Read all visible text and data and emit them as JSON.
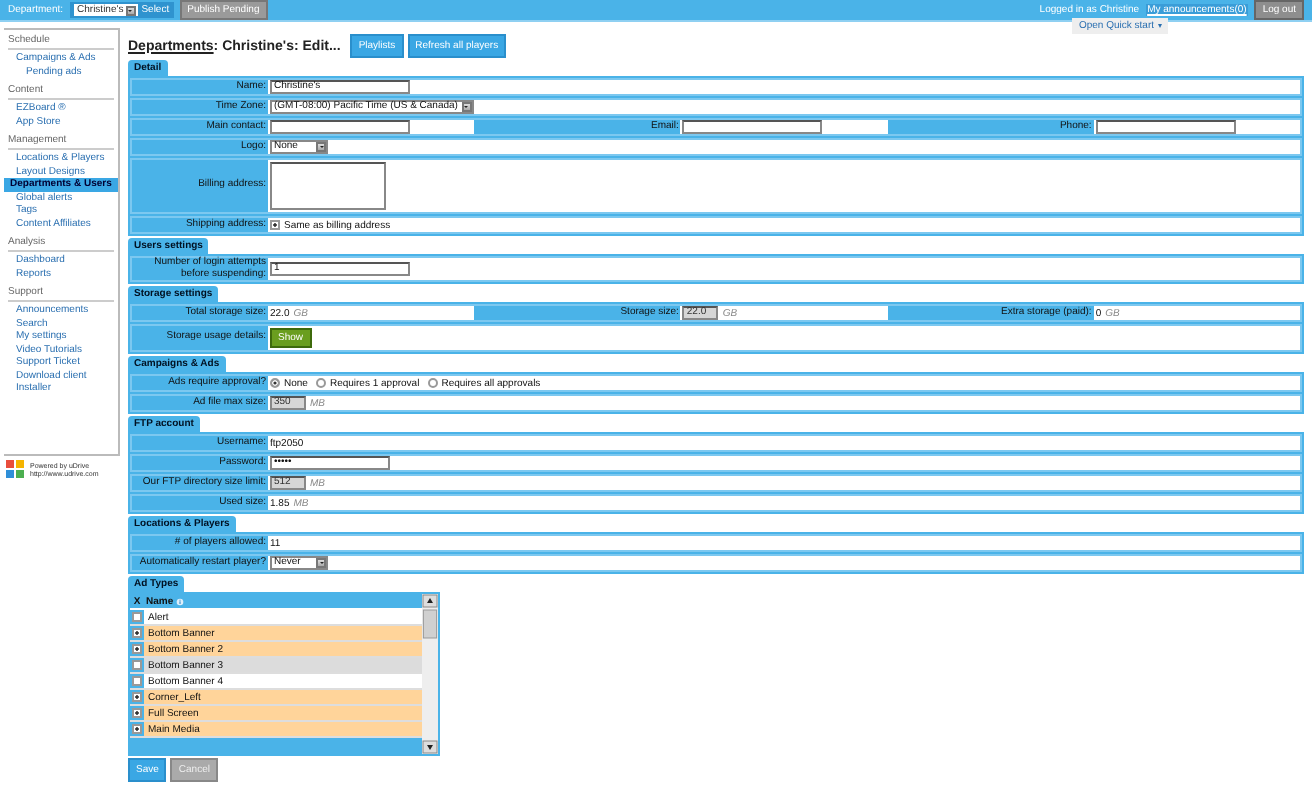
{
  "top_bar": {
    "department_label": "Department:",
    "department_select": "Christine's",
    "select_button": "Select",
    "publish_button": "Publish Pending",
    "logged_in": "Logged in as Christine",
    "announcements_link": "My announcements(0)",
    "logout_button": "Log out"
  },
  "quick_start": "Open Quick start",
  "sidebar": {
    "groups": [
      {
        "title": "Schedule",
        "items": [
          {
            "label": "Campaigns & Ads",
            "selected": false,
            "children": [
              {
                "label": "Pending ads",
                "selected": false
              }
            ]
          }
        ]
      },
      {
        "title": "Content",
        "items": [
          {
            "label": "EZBoard ®",
            "selected": false
          },
          {
            "label": "App Store",
            "selected": false
          }
        ]
      },
      {
        "title": "Management",
        "items": [
          {
            "label": "Locations & Players",
            "selected": false
          },
          {
            "label": "Layout Designs",
            "selected": false
          },
          {
            "label": "Departments & Users",
            "selected": true
          },
          {
            "label": "Global alerts",
            "selected": false
          },
          {
            "label": "Tags",
            "selected": false
          },
          {
            "label": "Content Affiliates",
            "selected": false
          }
        ]
      },
      {
        "title": "Analysis",
        "items": [
          {
            "label": "Dashboard",
            "selected": false
          },
          {
            "label": "Reports",
            "selected": false
          }
        ]
      },
      {
        "title": "Support",
        "items": [
          {
            "label": "Announcements",
            "selected": false
          },
          {
            "label": "Search",
            "selected": false
          },
          {
            "label": "My settings",
            "selected": false
          },
          {
            "label": "Video Tutorials",
            "selected": false
          },
          {
            "label": "Support Ticket",
            "selected": false
          },
          {
            "label": "Download client",
            "selected": false
          },
          {
            "label": "Installer",
            "selected": false
          }
        ]
      }
    ],
    "powered_by": "Powered by uDrive",
    "powered_url": "http://www.udrive.com"
  },
  "page": {
    "breadcrumb_link": "Departments",
    "title_rest": ": Christine's: Edit...",
    "buttons": [
      "Playlists",
      "Refresh all players"
    ]
  },
  "sections": [
    {
      "title": "Detail",
      "rows": [
        {
          "pairs": [
            {
              "label": "Name:",
              "field": {
                "kind": "text",
                "value": "Christine's"
              }
            }
          ]
        },
        {
          "pairs": [
            {
              "label": "Time Zone:",
              "field": {
                "kind": "select",
                "value": "(GMT-08:00) Pacific Time (US & Canada)"
              }
            }
          ]
        },
        {
          "pairs": [
            {
              "label": "Main contact:",
              "field": {
                "kind": "text"
              }
            },
            {
              "label": "Email:",
              "field": {
                "kind": "text"
              }
            },
            {
              "label": "Phone:",
              "field": {
                "kind": "text"
              }
            }
          ]
        },
        {
          "pairs": [
            {
              "label": "Logo:",
              "field": {
                "kind": "select",
                "value": "None"
              }
            }
          ]
        },
        {
          "pairs": [
            {
              "label": "Billing address:",
              "field": {
                "kind": "textarea"
              }
            }
          ]
        },
        {
          "pairs": [
            {
              "label": "Shipping address:",
              "field": {
                "kind": "checkbox",
                "checked": true,
                "label": "Same as billing address"
              }
            }
          ]
        }
      ]
    },
    {
      "title": "Users settings",
      "rows": [
        {
          "pairs": [
            {
              "label": "Number of login attempts before suspending:",
              "field": {
                "kind": "text",
                "value": "1"
              }
            }
          ]
        }
      ]
    },
    {
      "title": "Storage settings",
      "rows": [
        {
          "pairs": [
            {
              "label": "Total storage size:",
              "field": {
                "kind": "static",
                "value": "22.0",
                "unit": "GB"
              }
            },
            {
              "label": "Storage size:",
              "field": {
                "kind": "text",
                "value": "22.0",
                "disabled": true,
                "unit": "GB"
              }
            },
            {
              "label": "Extra storage (paid):",
              "field": {
                "kind": "static",
                "value": "0",
                "unit": "GB"
              }
            }
          ]
        },
        {
          "pairs": [
            {
              "label": "Storage usage details:",
              "field": {
                "kind": "button",
                "label": "Show"
              }
            }
          ]
        }
      ]
    },
    {
      "title": "Campaigns & Ads",
      "rows": [
        {
          "pairs": [
            {
              "label": "Ads require approval?",
              "field": {
                "kind": "radios",
                "options": [
                  {
                    "label": "None",
                    "selected": true
                  },
                  {
                    "label": "Requires 1 approval",
                    "selected": false
                  },
                  {
                    "label": "Requires all approvals",
                    "selected": false
                  }
                ]
              }
            }
          ]
        },
        {
          "pairs": [
            {
              "label": "Ad file max size:",
              "field": {
                "kind": "text",
                "value": "350",
                "disabled": true,
                "unit": "MB"
              }
            }
          ]
        }
      ]
    },
    {
      "title": "FTP account",
      "rows": [
        {
          "pairs": [
            {
              "label": "Username:",
              "field": {
                "kind": "static",
                "value": "ftp2050"
              }
            }
          ]
        },
        {
          "pairs": [
            {
              "label": "Password:",
              "field": {
                "kind": "password",
                "value": "•••••"
              }
            }
          ]
        },
        {
          "pairs": [
            {
              "label": "Our FTP directory size limit:",
              "field": {
                "kind": "text",
                "value": "512",
                "disabled": true,
                "unit": "MB"
              }
            }
          ]
        },
        {
          "pairs": [
            {
              "label": "Used size:",
              "field": {
                "kind": "static",
                "value": "1.85",
                "unit": "MB"
              }
            }
          ]
        }
      ]
    },
    {
      "title": "Locations & Players",
      "rows": [
        {
          "pairs": [
            {
              "label": "# of players allowed:",
              "field": {
                "kind": "static",
                "value": "11"
              }
            }
          ]
        },
        {
          "pairs": [
            {
              "label": "Automatically restart player?",
              "field": {
                "kind": "select",
                "value": "Never"
              }
            }
          ]
        }
      ]
    }
  ],
  "ad_types": {
    "title": "Ad Types",
    "columns": [
      "X",
      "Name"
    ],
    "rows": [
      {
        "name": "Alert",
        "checked": false,
        "hovered": false
      },
      {
        "name": "Bottom Banner",
        "checked": true,
        "hovered": false
      },
      {
        "name": "Bottom Banner 2",
        "checked": true,
        "hovered": false
      },
      {
        "name": "Bottom Banner 3",
        "checked": false,
        "hovered": true
      },
      {
        "name": "Bottom Banner 4",
        "checked": false,
        "hovered": false
      },
      {
        "name": "Corner_Left",
        "checked": true,
        "hovered": false
      },
      {
        "name": "Full Screen",
        "checked": true,
        "hovered": false
      },
      {
        "name": "Main Media",
        "checked": true,
        "hovered": false
      }
    ]
  },
  "form_buttons": [
    {
      "label": "Save",
      "disabled": false
    },
    {
      "label": "Cancel",
      "disabled": true
    }
  ]
}
